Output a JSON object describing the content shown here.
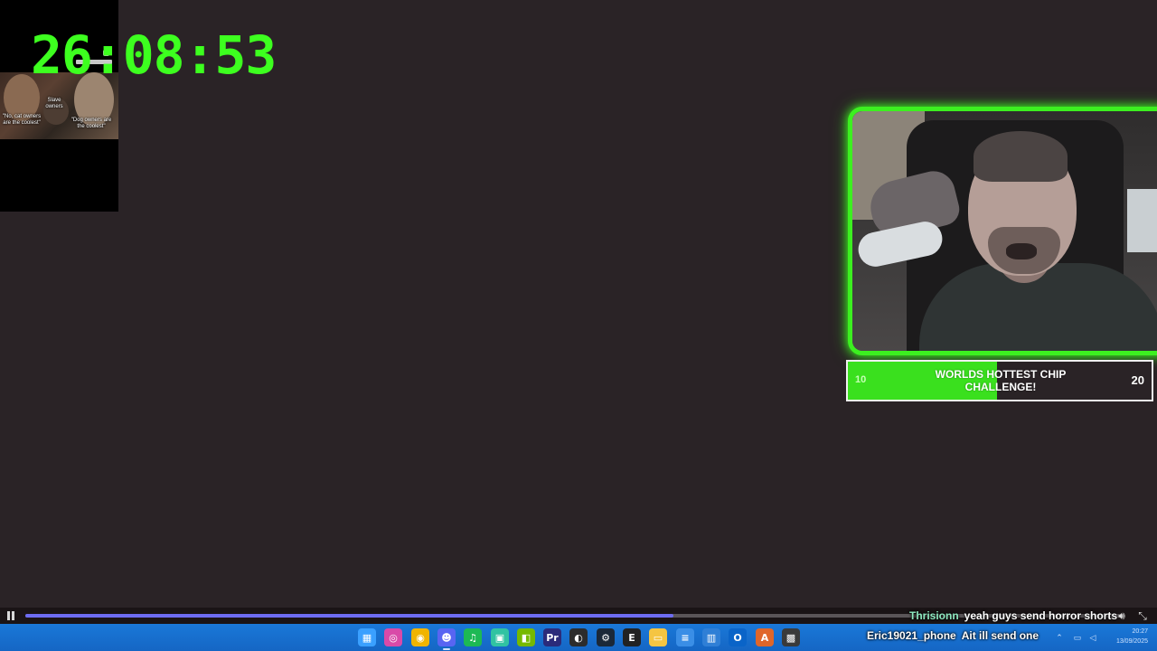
{
  "timer": {
    "text": "26:08:53",
    "color": "#3dff1f"
  },
  "mini_video": {
    "caption_left": "\"No, cat owners are the coolest\"",
    "caption_mid": "Slave owners",
    "caption_right": "\"Dog owners are the coolest\""
  },
  "goal": {
    "title_line1": "WORLDS HOTTEST CHIP",
    "title_line2": "CHALLENGE!",
    "min": "10",
    "max": "20",
    "progress_fraction": 0.49,
    "fill_color": "#3ae01e"
  },
  "player": {
    "seek_fraction": 0.59,
    "accent": "#6d6cf2"
  },
  "chat": [
    {
      "user": "Thrisionn",
      "message": "yeah guys send horror shorts",
      "user_color": "#8ee9c0"
    },
    {
      "user": "Eric19021_phone",
      "message": "Ait ill send one",
      "user_color": "#ffffff"
    }
  ],
  "taskbar": {
    "icons": [
      {
        "name": "windows-start-icon",
        "glyph": "▦",
        "color": "#3aa0ff"
      },
      {
        "name": "search-icon",
        "glyph": "◎",
        "color": "#d94aa8"
      },
      {
        "name": "chrome-icon",
        "glyph": "◉",
        "color": "#f0b400"
      },
      {
        "name": "discord-icon",
        "glyph": "☻",
        "color": "#5865f2"
      },
      {
        "name": "spotify-icon",
        "glyph": "♫",
        "color": "#1db954"
      },
      {
        "name": "streamlabs-icon",
        "glyph": "▣",
        "color": "#31c3a2"
      },
      {
        "name": "nvidia-icon",
        "glyph": "◧",
        "color": "#76b900"
      },
      {
        "name": "premiere-pro-icon",
        "glyph": "Pr",
        "color": "#2b2b7a"
      },
      {
        "name": "obs-icon",
        "glyph": "◐",
        "color": "#2c2c2c"
      },
      {
        "name": "steam-icon",
        "glyph": "⚙",
        "color": "#1b2838"
      },
      {
        "name": "epic-games-icon",
        "glyph": "E",
        "color": "#222222"
      },
      {
        "name": "file-explorer-icon",
        "glyph": "▭",
        "color": "#f5c542"
      },
      {
        "name": "notepad-icon",
        "glyph": "≡",
        "color": "#3a8ee6"
      },
      {
        "name": "task-manager-icon",
        "glyph": "▥",
        "color": "#2f7fd6"
      },
      {
        "name": "outlook-icon",
        "glyph": "O",
        "color": "#0a64c8"
      },
      {
        "name": "app-a-icon",
        "glyph": "A",
        "color": "#e0662a"
      },
      {
        "name": "minecraft-icon",
        "glyph": "▩",
        "color": "#3a3a3a"
      }
    ],
    "time": "20:27",
    "date": "13/09/2025"
  }
}
